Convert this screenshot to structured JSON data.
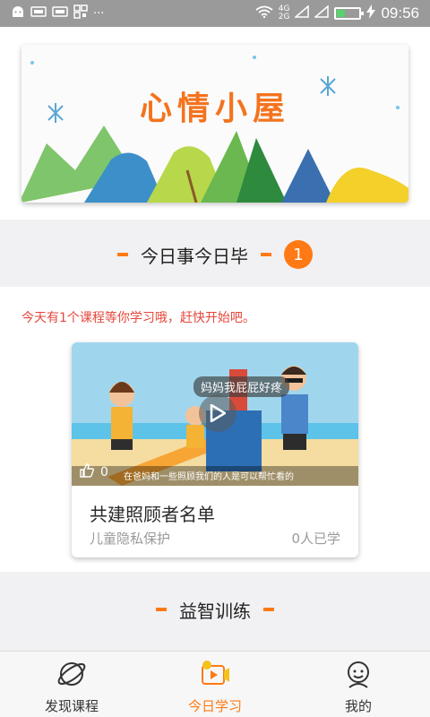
{
  "status_bar": {
    "left_icons": [
      "android-icon",
      "sim-icon",
      "sim-icon",
      "qr-icon"
    ],
    "more": "···",
    "network_top": "4G",
    "network_bottom": "2G",
    "time": "09:56",
    "battery_level": 0.35
  },
  "banner": {
    "title": "心情小屋"
  },
  "section1": {
    "title": "今日事今日毕",
    "badge": "1"
  },
  "notice": "今天有1个课程等你学习哦，赶快开始吧。",
  "course_card": {
    "speech_bubble": "妈妈我屁屁好疼",
    "likes": "0",
    "caption": "在爸妈和一些照顾我们的人是可以帮忙看的",
    "title": "共建照顾者名单",
    "category": "儿童隐私保护",
    "learners": "0人已学"
  },
  "section2": {
    "title": "益智训练"
  },
  "bottom_nav": {
    "items": [
      {
        "label": "发现课程",
        "icon": "planet-icon",
        "active": false
      },
      {
        "label": "今日学习",
        "icon": "video-play-icon",
        "active": true
      },
      {
        "label": "我的",
        "icon": "face-icon",
        "active": false
      }
    ]
  },
  "colors": {
    "accent": "#ff7a14",
    "notice": "#e4473b"
  }
}
